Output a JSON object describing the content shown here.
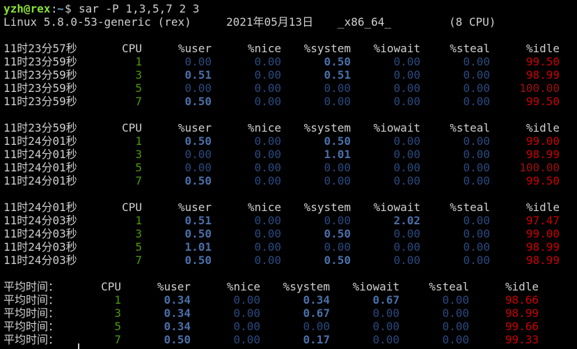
{
  "prompt": {
    "user_host": "yzh@rex",
    "sep": ":",
    "path": "~",
    "symbol": "$",
    "command": "sar -P 1,3,5,7 2 3"
  },
  "sysinfo": {
    "kernel": "Linux 5.8.0-53-generic (rex)",
    "date": "2021年05月13日",
    "arch": "_x86_64_",
    "cpus": "(8 CPU)"
  },
  "columns": [
    "CPU",
    "%user",
    "%nice",
    "%system",
    "%iowait",
    "%steal",
    "%idle"
  ],
  "blocks": [
    {
      "header_time": "11时23分57秒",
      "rows": [
        {
          "time": "11时23分59秒",
          "cpu": "1",
          "user": "0.00",
          "nice": "0.00",
          "system": "0.50",
          "iowait": "0.00",
          "steal": "0.00",
          "idle": "99.50"
        },
        {
          "time": "11时23分59秒",
          "cpu": "3",
          "user": "0.51",
          "nice": "0.00",
          "system": "0.51",
          "iowait": "0.00",
          "steal": "0.00",
          "idle": "98.99"
        },
        {
          "time": "11时23分59秒",
          "cpu": "5",
          "user": "0.00",
          "nice": "0.00",
          "system": "0.00",
          "iowait": "0.00",
          "steal": "0.00",
          "idle": "100.00"
        },
        {
          "time": "11时23分59秒",
          "cpu": "7",
          "user": "0.50",
          "nice": "0.00",
          "system": "0.00",
          "iowait": "0.00",
          "steal": "0.00",
          "idle": "99.50"
        }
      ]
    },
    {
      "header_time": "11时23分59秒",
      "rows": [
        {
          "time": "11时24分01秒",
          "cpu": "1",
          "user": "0.50",
          "nice": "0.00",
          "system": "0.50",
          "iowait": "0.00",
          "steal": "0.00",
          "idle": "99.00"
        },
        {
          "time": "11时24分01秒",
          "cpu": "3",
          "user": "0.00",
          "nice": "0.00",
          "system": "1.01",
          "iowait": "0.00",
          "steal": "0.00",
          "idle": "98.99"
        },
        {
          "time": "11时24分01秒",
          "cpu": "5",
          "user": "0.00",
          "nice": "0.00",
          "system": "0.00",
          "iowait": "0.00",
          "steal": "0.00",
          "idle": "100.00"
        },
        {
          "time": "11时24分01秒",
          "cpu": "7",
          "user": "0.50",
          "nice": "0.00",
          "system": "0.00",
          "iowait": "0.00",
          "steal": "0.00",
          "idle": "99.50"
        }
      ]
    },
    {
      "header_time": "11时24分01秒",
      "rows": [
        {
          "time": "11时24分03秒",
          "cpu": "1",
          "user": "0.51",
          "nice": "0.00",
          "system": "0.00",
          "iowait": "2.02",
          "steal": "0.00",
          "idle": "97.47"
        },
        {
          "time": "11时24分03秒",
          "cpu": "3",
          "user": "0.50",
          "nice": "0.00",
          "system": "0.50",
          "iowait": "0.00",
          "steal": "0.00",
          "idle": "99.00"
        },
        {
          "time": "11时24分03秒",
          "cpu": "5",
          "user": "1.01",
          "nice": "0.00",
          "system": "0.00",
          "iowait": "0.00",
          "steal": "0.00",
          "idle": "98.99"
        },
        {
          "time": "11时24分03秒",
          "cpu": "7",
          "user": "0.50",
          "nice": "0.00",
          "system": "0.50",
          "iowait": "0.00",
          "steal": "0.00",
          "idle": "98.99"
        }
      ]
    }
  ],
  "average": {
    "label": "平均时间：",
    "rows": [
      {
        "cpu": "1",
        "user": "0.34",
        "nice": "0.00",
        "system": "0.34",
        "iowait": "0.67",
        "steal": "0.00",
        "idle": "98.66"
      },
      {
        "cpu": "3",
        "user": "0.34",
        "nice": "0.00",
        "system": "0.67",
        "iowait": "0.00",
        "steal": "0.00",
        "idle": "98.99"
      },
      {
        "cpu": "5",
        "user": "0.34",
        "nice": "0.00",
        "system": "0.00",
        "iowait": "0.00",
        "steal": "0.00",
        "idle": "99.66"
      },
      {
        "cpu": "7",
        "user": "0.50",
        "nice": "0.00",
        "system": "0.17",
        "iowait": "0.00",
        "steal": "0.00",
        "idle": "99.33"
      }
    ]
  },
  "colors": {
    "background": "#000000",
    "prompt_user": "#8ae234",
    "prompt_path": "#729fcf",
    "cpu": "#4e9a06",
    "value_nonzero": "#4a6fa8",
    "value_zero": "#2a4a80",
    "idle": "#cc0000"
  }
}
